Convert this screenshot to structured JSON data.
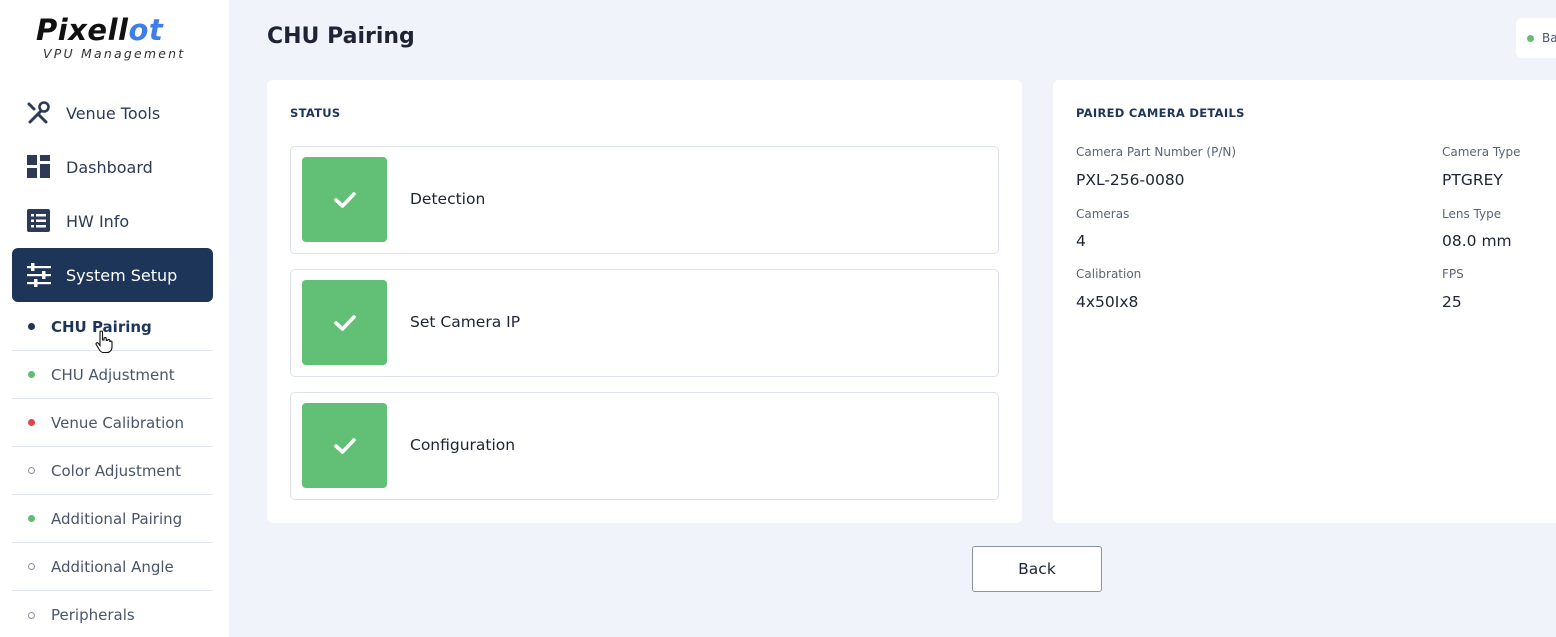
{
  "brand": {
    "logo_part1": "Pixell",
    "logo_part2": "ot",
    "subtitle": "VPU Management",
    "accent_color": "#3f7de8"
  },
  "sidebar": {
    "items": [
      {
        "label": "Venue Tools",
        "icon": "tools-icon"
      },
      {
        "label": "Dashboard",
        "icon": "dashboard-grid-icon"
      },
      {
        "label": "HW Info",
        "icon": "list-icon"
      },
      {
        "label": "System Setup",
        "icon": "sliders-icon",
        "active": true
      }
    ],
    "subitems": [
      {
        "label": "CHU Pairing",
        "status": "current"
      },
      {
        "label": "CHU Adjustment",
        "status": "done"
      },
      {
        "label": "Venue Calibration",
        "status": "error"
      },
      {
        "label": "Color Adjustment",
        "status": "pending"
      },
      {
        "label": "Additional Pairing",
        "status": "done"
      },
      {
        "label": "Additional Angle",
        "status": "pending"
      },
      {
        "label": "Peripherals",
        "status": "pending"
      }
    ],
    "active_color": "#1e355a"
  },
  "header": {
    "title": "CHU Pairing",
    "badge_text": "Ba"
  },
  "status": {
    "heading": "STATUS",
    "steps": [
      {
        "label": "Detection",
        "done": true
      },
      {
        "label": "Set Camera IP",
        "done": true
      },
      {
        "label": "Configuration",
        "done": true
      }
    ],
    "success_color": "#62bf76"
  },
  "details": {
    "heading": "PAIRED CAMERA DETAILS",
    "part_number_label": "Camera Part Number (P/N)",
    "part_number_value": "PXL-256-0080",
    "camera_type_label": "Camera Type",
    "camera_type_value": "PTGREY",
    "cameras_label": "Cameras",
    "cameras_value": "4",
    "lens_type_label": "Lens Type",
    "lens_type_value": "08.0 mm",
    "calibration_label": "Calibration",
    "calibration_value": "4x50Ix8",
    "fps_label": "FPS",
    "fps_value": "25"
  },
  "actions": {
    "back_label": "Back"
  }
}
